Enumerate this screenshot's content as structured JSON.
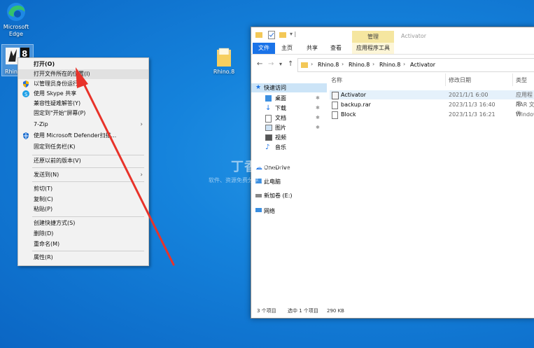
{
  "desktop": {
    "icons": [
      {
        "label": "Microsoft Edge"
      },
      {
        "label": "Rhino"
      },
      {
        "label": "Rhino.8"
      }
    ]
  },
  "context_menu": {
    "items": [
      {
        "label": "打开(O)"
      },
      {
        "label": "打开文件所在的位置(I)"
      },
      {
        "label": "以管理员身份运行(A)"
      },
      {
        "label": "使用 Skype 共享"
      },
      {
        "label": "兼容性疑难解答(Y)"
      },
      {
        "label": "固定到\"开始\"屏幕(P)"
      },
      {
        "label": "7-Zip"
      },
      {
        "label": "使用 Microsoft Defender扫描..."
      },
      {
        "label": "固定到任务栏(K)"
      },
      {
        "label": "还原以前的版本(V)"
      },
      {
        "label": "发送到(N)"
      },
      {
        "label": "剪切(T)"
      },
      {
        "label": "复制(C)"
      },
      {
        "label": "粘贴(P)"
      },
      {
        "label": "创建快捷方式(S)"
      },
      {
        "label": "删除(D)"
      },
      {
        "label": "重命名(M)"
      },
      {
        "label": "属性(R)"
      }
    ]
  },
  "explorer": {
    "title": "Activator",
    "manage_tab": "管理",
    "tabs": [
      "文件",
      "主页",
      "共享",
      "查看",
      "应用程序工具"
    ],
    "breadcrumb": [
      "Rhino.8",
      "Rhino.8",
      "Rhino.8",
      "Activator"
    ],
    "nav": [
      {
        "label": "快速访问"
      },
      {
        "label": "桌面"
      },
      {
        "label": "下载"
      },
      {
        "label": "文档"
      },
      {
        "label": "图片"
      },
      {
        "label": "视频"
      },
      {
        "label": "音乐"
      },
      {
        "label": "OneDrive"
      },
      {
        "label": "此电脑"
      },
      {
        "label": "新加卷 (E:)"
      },
      {
        "label": "网络"
      }
    ],
    "columns": [
      "名称",
      "修改日期",
      "类型"
    ],
    "files": [
      {
        "name": "Activator",
        "date": "2021/1/1 6:00",
        "type": "应用程序"
      },
      {
        "name": "backup.rar",
        "date": "2023/11/3 16:40",
        "type": "RAR 文件"
      },
      {
        "name": "Block",
        "date": "2023/11/3 16:21",
        "type": "Windows"
      }
    ],
    "status": {
      "count": "3 个项目",
      "selected": "选中 1 个项目",
      "size": "290 KB"
    }
  },
  "watermark": {
    "line1": "丁香学日记本",
    "line2": "软件、资源免费分享下载"
  },
  "colors": {
    "accent": "#1a73e8",
    "desktop": "#1583dc",
    "arrow": "#e8332a"
  }
}
